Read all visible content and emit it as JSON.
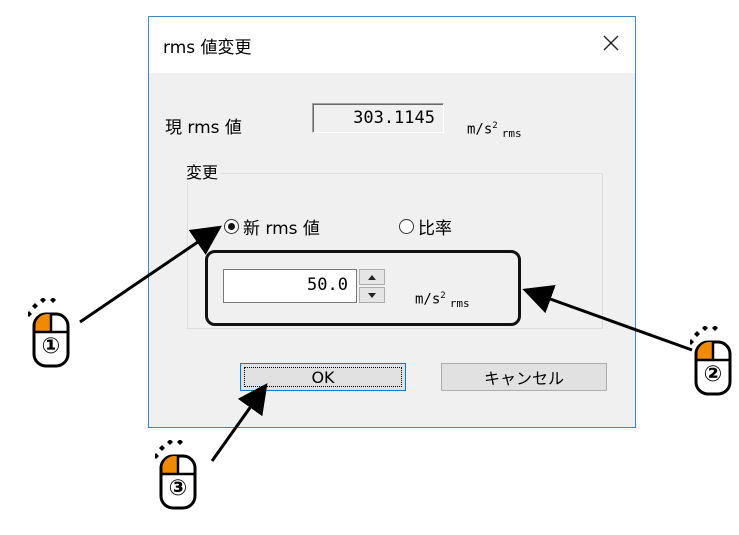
{
  "dialog": {
    "title": "rms 値変更",
    "close_glyph": "✕",
    "current": {
      "label": "現 rms 値",
      "value": "303.1145",
      "unit_base": "m/s",
      "unit_sup": "2",
      "unit_sub": "rms"
    },
    "group": {
      "label": "変更",
      "radio_new_label": "新 rms 値",
      "radio_ratio_label": "比率",
      "selected": "new",
      "new_value": "50.0",
      "unit_base": "m/s",
      "unit_sup": "2",
      "unit_sub": "rms"
    },
    "buttons": {
      "ok": "OK",
      "cancel": "キャンセル"
    }
  },
  "callouts": [
    {
      "number": "①",
      "target": "radio-new"
    },
    {
      "number": "②",
      "target": "value-input-area"
    },
    {
      "number": "③",
      "target": "ok-button"
    }
  ],
  "colors": {
    "dialog_bg": "#f0f0f0",
    "accent_border": "#3c87d1",
    "mouse_highlight": "#f08a00"
  }
}
